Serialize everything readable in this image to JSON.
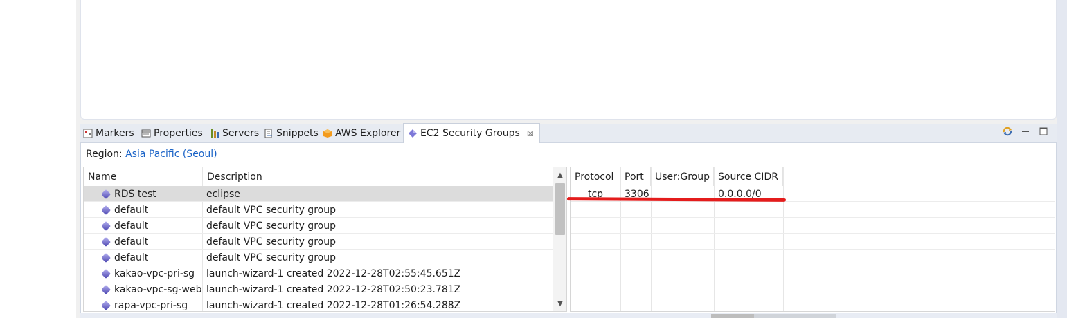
{
  "tabs": [
    {
      "label": "Markers",
      "icon": "markers-icon"
    },
    {
      "label": "Properties",
      "icon": "properties-icon"
    },
    {
      "label": "Servers",
      "icon": "servers-icon"
    },
    {
      "label": "Snippets",
      "icon": "snippets-icon"
    },
    {
      "label": "AWS Explorer",
      "icon": "aws-explorer-icon"
    },
    {
      "label": "EC2 Security Groups",
      "icon": "security-group-icon",
      "close": "☒"
    }
  ],
  "region": {
    "label": "Region:",
    "value": "Asia Pacific (Seoul)"
  },
  "groups_table": {
    "headers": {
      "name": "Name",
      "description": "Description"
    },
    "rows": [
      {
        "name": "RDS test",
        "description": "eclipse"
      },
      {
        "name": "default",
        "description": "default VPC security group"
      },
      {
        "name": "default",
        "description": "default VPC security group"
      },
      {
        "name": "default",
        "description": "default VPC security group"
      },
      {
        "name": "default",
        "description": "default VPC security group"
      },
      {
        "name": "kakao-vpc-pri-sg",
        "description": "launch-wizard-1 created 2022-12-28T02:55:45.651Z"
      },
      {
        "name": "kakao-vpc-sg-web",
        "description": "launch-wizard-1 created 2022-12-28T02:50:23.781Z"
      },
      {
        "name": "rapa-vpc-pri-sg",
        "description": "launch-wizard-1 created 2022-12-28T01:26:54.288Z"
      }
    ]
  },
  "permissions_table": {
    "headers": {
      "protocol": "Protocol",
      "port": "Port",
      "user_group": "User:Group",
      "source_cidr": "Source CIDR"
    },
    "rows": [
      {
        "protocol": "tcp",
        "port": "3306",
        "user_group": "",
        "source_cidr": "0.0.0.0/0"
      }
    ]
  },
  "colors": {
    "link": "#1a63c7",
    "highlight_line": "#e41c1c",
    "selected_row": "#dcdcdc"
  }
}
